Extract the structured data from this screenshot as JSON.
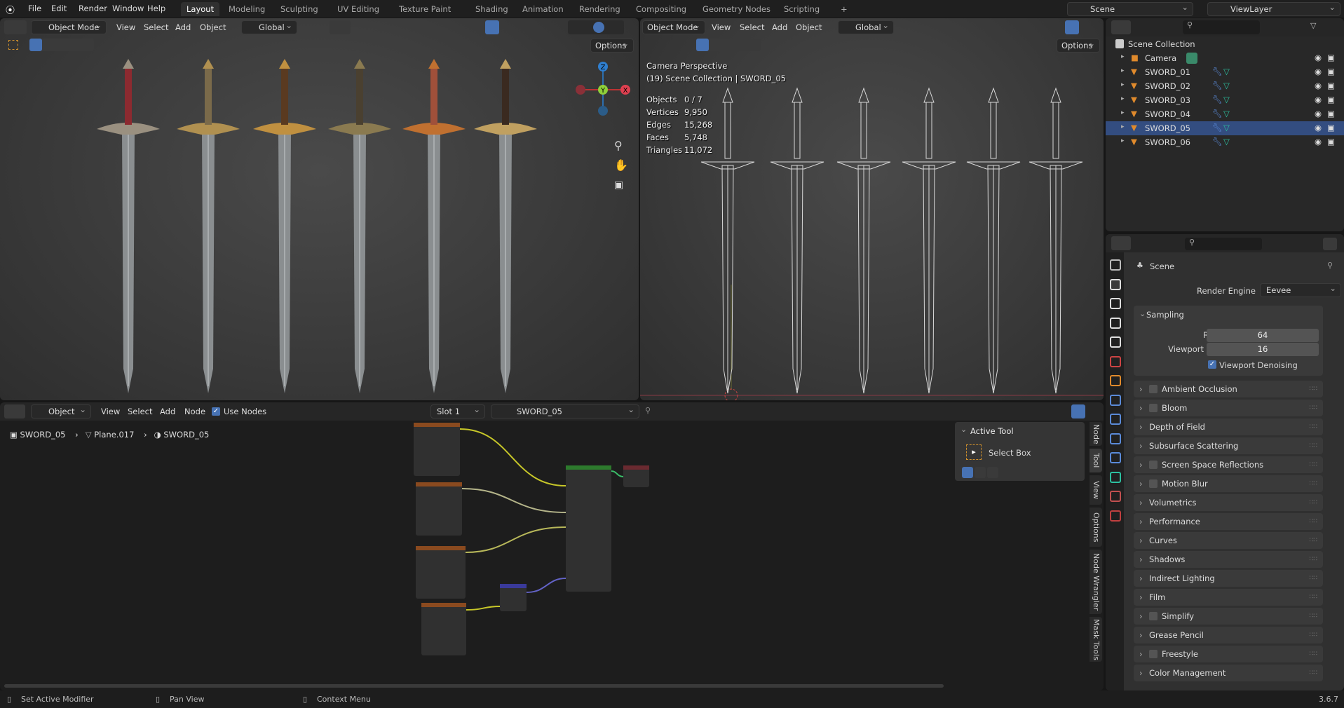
{
  "topbar": {
    "menus": [
      "File",
      "Edit",
      "Render",
      "Window",
      "Help"
    ],
    "workspaces": [
      "Layout",
      "Modeling",
      "Sculpting",
      "UV Editing",
      "Texture Paint",
      "Shading",
      "Animation",
      "Rendering",
      "Compositing",
      "Geometry Nodes",
      "Scripting"
    ],
    "active_workspace": "Layout",
    "add_workspace": "+",
    "scene": "Scene",
    "view_layer": "ViewLayer"
  },
  "viewport_left": {
    "mode": "Object Mode",
    "menus": [
      "View",
      "Select",
      "Add",
      "Object"
    ],
    "orientation": "Global",
    "options": "Options",
    "gizmo": {
      "x": "X",
      "y": "Y",
      "z": "Z"
    }
  },
  "viewport_right": {
    "mode": "Object Mode",
    "menus": [
      "View",
      "Select",
      "Add",
      "Object"
    ],
    "orientation": "Global",
    "options": "Options",
    "title": "Camera Perspective",
    "subtitle": "(19) Scene Collection | SWORD_05",
    "stats": [
      {
        "label": "Objects",
        "value": "0 / 7"
      },
      {
        "label": "Vertices",
        "value": "9,950"
      },
      {
        "label": "Edges",
        "value": "15,268"
      },
      {
        "label": "Faces",
        "value": "5,748"
      },
      {
        "label": "Triangles",
        "value": "11,072"
      }
    ]
  },
  "outliner": {
    "root": "Scene Collection",
    "items": [
      "Camera",
      "SWORD_01",
      "SWORD_02",
      "SWORD_03",
      "SWORD_04",
      "SWORD_05",
      "SWORD_06"
    ],
    "active": "SWORD_05"
  },
  "properties": {
    "context": "Scene",
    "render_engine_label": "Render Engine",
    "render_engine": "Eevee",
    "sampling": {
      "title": "Sampling",
      "render_label": "Render",
      "render": "64",
      "viewport_label": "Viewport",
      "viewport": "16",
      "denoise_label": "Viewport Denoising",
      "denoise": true
    },
    "panels": [
      {
        "label": "Ambient Occlusion",
        "checkbox": true
      },
      {
        "label": "Bloom",
        "checkbox": true
      },
      {
        "label": "Depth of Field",
        "checkbox": false
      },
      {
        "label": "Subsurface Scattering",
        "checkbox": false
      },
      {
        "label": "Screen Space Reflections",
        "checkbox": true
      },
      {
        "label": "Motion Blur",
        "checkbox": true
      },
      {
        "label": "Volumetrics",
        "checkbox": false
      },
      {
        "label": "Performance",
        "checkbox": false
      },
      {
        "label": "Curves",
        "checkbox": false
      },
      {
        "label": "Shadows",
        "checkbox": false
      },
      {
        "label": "Indirect Lighting",
        "checkbox": false
      },
      {
        "label": "Film",
        "checkbox": false
      },
      {
        "label": "Simplify",
        "checkbox": true
      },
      {
        "label": "Grease Pencil",
        "checkbox": false
      },
      {
        "label": "Freestyle",
        "checkbox": true
      },
      {
        "label": "Color Management",
        "checkbox": false
      }
    ]
  },
  "node_editor": {
    "type": "Object",
    "menus": [
      "View",
      "Select",
      "Add",
      "Node"
    ],
    "use_nodes_label": "Use Nodes",
    "use_nodes": true,
    "slot": "Slot 1",
    "material": "SWORD_05",
    "breadcrumb": [
      "SWORD_05",
      "Plane.017",
      "SWORD_05"
    ],
    "npanel": {
      "title": "Active Tool",
      "tool": "Select Box",
      "tabs": [
        "Node",
        "Tool",
        "View",
        "Options",
        "Node Wrangler",
        "Mask Tools"
      ]
    }
  },
  "status": {
    "items": [
      "Set Active Modifier",
      "Pan View",
      "Context Menu"
    ],
    "version": "3.6.7"
  }
}
